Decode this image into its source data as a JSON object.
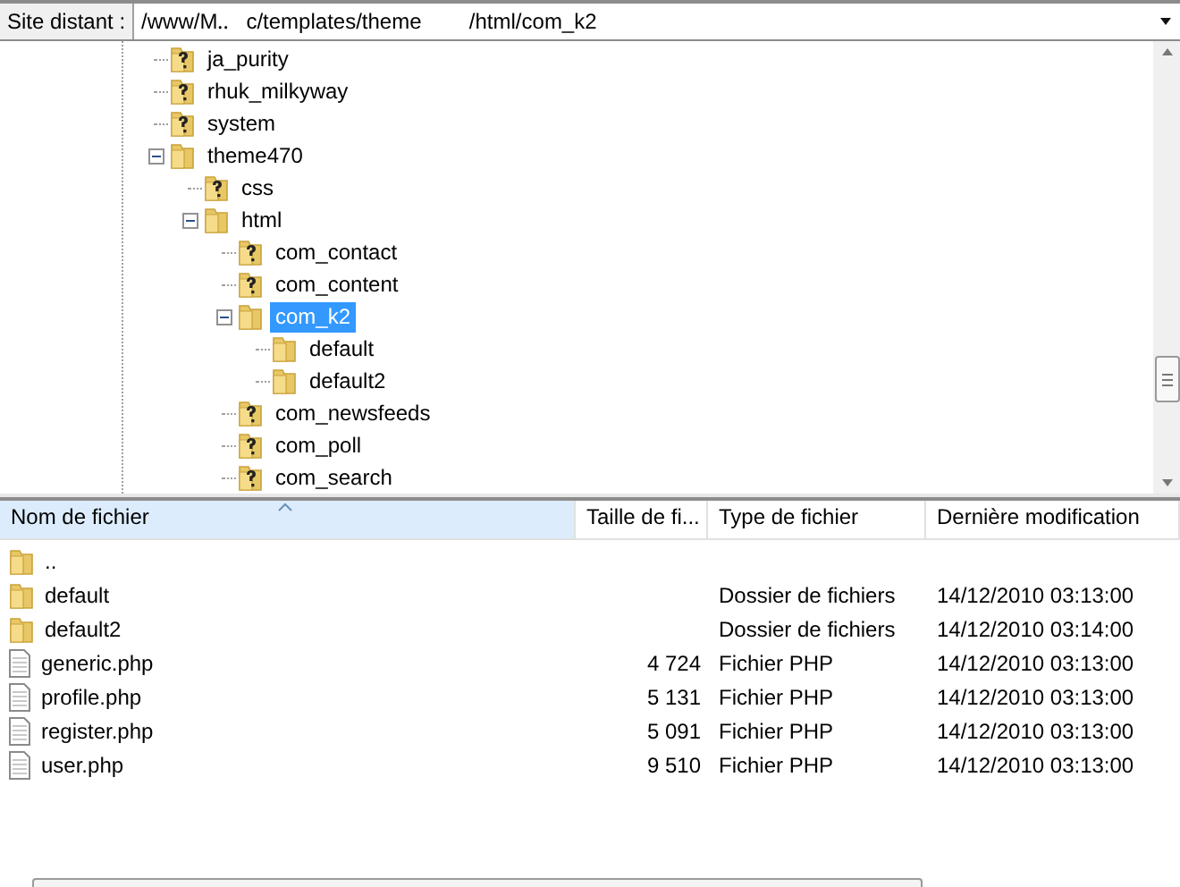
{
  "remote_site": {
    "label": "Site distant :",
    "value": "/www/M‥   c/templates/theme        /html/com_k2"
  },
  "tree": [
    {
      "name": "ja_purity",
      "kind": "unknown"
    },
    {
      "name": "rhuk_milkyway",
      "kind": "unknown"
    },
    {
      "name": "system",
      "kind": "unknown"
    },
    {
      "name": "theme470",
      "kind": "folder",
      "expanded": true,
      "selected": false,
      "children": [
        {
          "name": "css",
          "kind": "unknown"
        },
        {
          "name": "html",
          "kind": "folder",
          "expanded": true,
          "selected": false,
          "children": [
            {
              "name": "com_contact",
              "kind": "unknown"
            },
            {
              "name": "com_content",
              "kind": "unknown"
            },
            {
              "name": "com_k2",
              "kind": "folder",
              "expanded": true,
              "selected": true,
              "children": [
                {
                  "name": "default",
                  "kind": "folder"
                },
                {
                  "name": "default2",
                  "kind": "folder"
                }
              ]
            },
            {
              "name": "com_newsfeeds",
              "kind": "unknown"
            },
            {
              "name": "com_poll",
              "kind": "unknown"
            },
            {
              "name": "com_search",
              "kind": "unknown"
            }
          ]
        }
      ]
    }
  ],
  "table": {
    "columns": [
      "Nom de fichier",
      "Taille de fi...",
      "Type de fichier",
      "Dernière modification"
    ],
    "rows": [
      {
        "kind": "folder",
        "name": "..",
        "size": "",
        "type": "",
        "modified": ""
      },
      {
        "kind": "folder",
        "name": "default",
        "size": "",
        "type": "Dossier de fichiers",
        "modified": "14/12/2010 03:13:00"
      },
      {
        "kind": "folder",
        "name": "default2",
        "size": "",
        "type": "Dossier de fichiers",
        "modified": "14/12/2010 03:14:00"
      },
      {
        "kind": "file",
        "name": "generic.php",
        "size": "4 724",
        "type": "Fichier PHP",
        "modified": "14/12/2010 03:13:00"
      },
      {
        "kind": "file",
        "name": "profile.php",
        "size": "5 131",
        "type": "Fichier PHP",
        "modified": "14/12/2010 03:13:00"
      },
      {
        "kind": "file",
        "name": "register.php",
        "size": "5 091",
        "type": "Fichier PHP",
        "modified": "14/12/2010 03:13:00"
      },
      {
        "kind": "file",
        "name": "user.php",
        "size": "9 510",
        "type": "Fichier PHP",
        "modified": "14/12/2010 03:13:00"
      }
    ]
  }
}
